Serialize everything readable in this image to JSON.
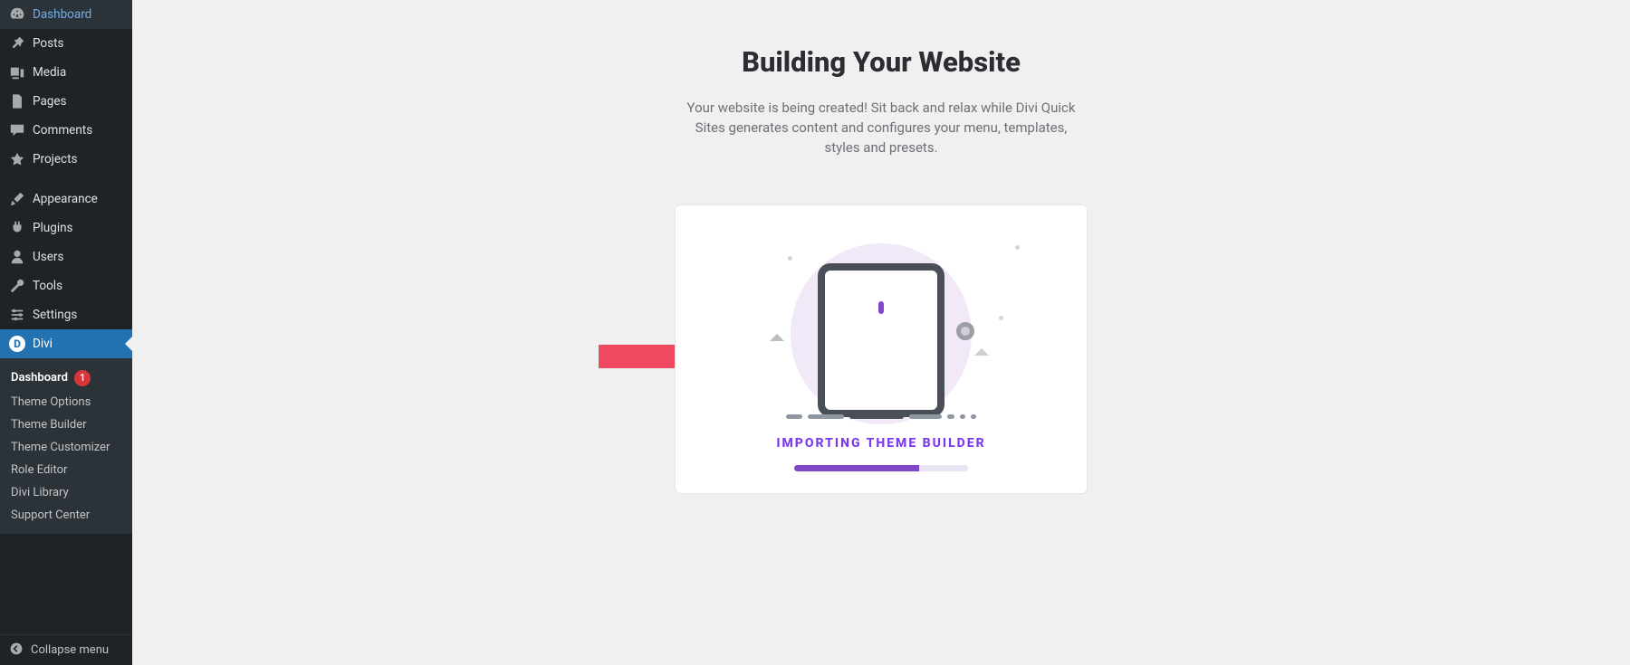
{
  "sidebar": {
    "items": [
      {
        "label": "Dashboard",
        "icon": "dashboard"
      },
      {
        "label": "Posts",
        "icon": "pin"
      },
      {
        "label": "Media",
        "icon": "media"
      },
      {
        "label": "Pages",
        "icon": "pages"
      },
      {
        "label": "Comments",
        "icon": "comment"
      },
      {
        "label": "Projects",
        "icon": "star"
      },
      {
        "label": "Appearance",
        "icon": "brush"
      },
      {
        "label": "Plugins",
        "icon": "plug"
      },
      {
        "label": "Users",
        "icon": "user"
      },
      {
        "label": "Tools",
        "icon": "wrench"
      },
      {
        "label": "Settings",
        "icon": "sliders"
      },
      {
        "label": "Divi",
        "icon": "divi"
      }
    ],
    "separator_after_index": 5,
    "active_index": 11,
    "submenu": [
      {
        "label": "Dashboard",
        "badge": "1",
        "current": true
      },
      {
        "label": "Theme Options"
      },
      {
        "label": "Theme Builder"
      },
      {
        "label": "Theme Customizer"
      },
      {
        "label": "Role Editor"
      },
      {
        "label": "Divi Library"
      },
      {
        "label": "Support Center"
      }
    ],
    "collapse_label": "Collapse menu"
  },
  "main": {
    "title": "Building Your Website",
    "subtitle": "Your website is being created! Sit back and relax while Divi Quick Sites generates content and configures your menu, templates, styles and presets.",
    "status": "IMPORTING THEME BUILDER",
    "progress_pct": 72
  }
}
